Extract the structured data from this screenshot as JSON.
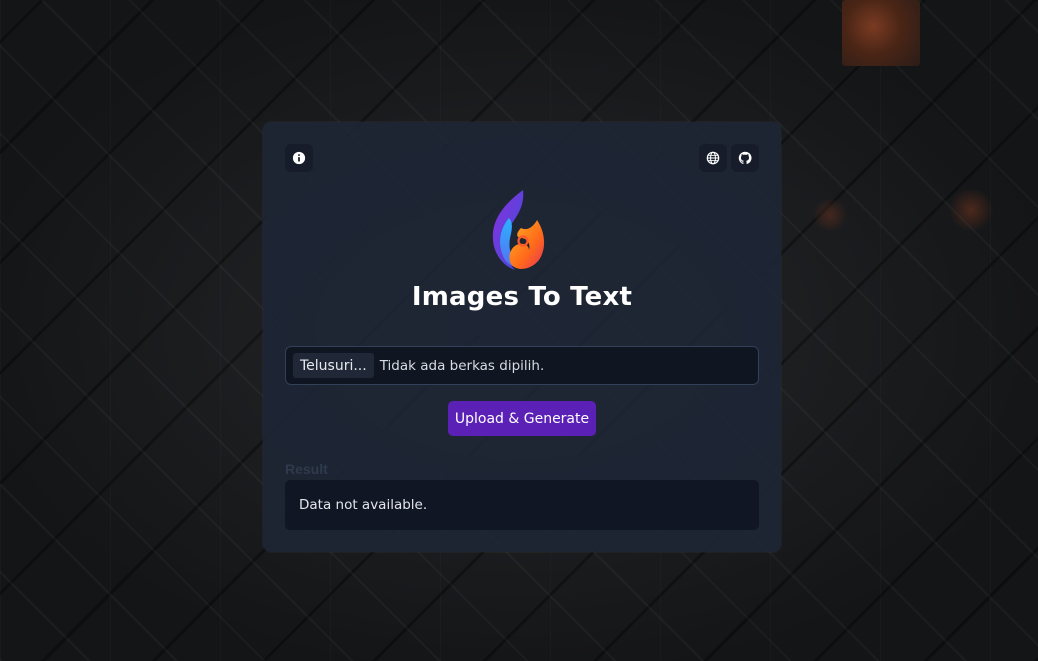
{
  "app": {
    "title": "Images To Text"
  },
  "header": {
    "info_icon": "info-icon",
    "globe_icon": "globe-icon",
    "github_icon": "github-icon"
  },
  "file_input": {
    "browse_label": "Telusuri...",
    "status": "Tidak ada berkas dipilih."
  },
  "actions": {
    "upload_label": "Upload & Generate"
  },
  "result": {
    "label": "Result",
    "content": "Data not available."
  },
  "colors": {
    "primary_button": "#5b21b6",
    "card_background": "#1e2636",
    "input_background": "#101522"
  }
}
